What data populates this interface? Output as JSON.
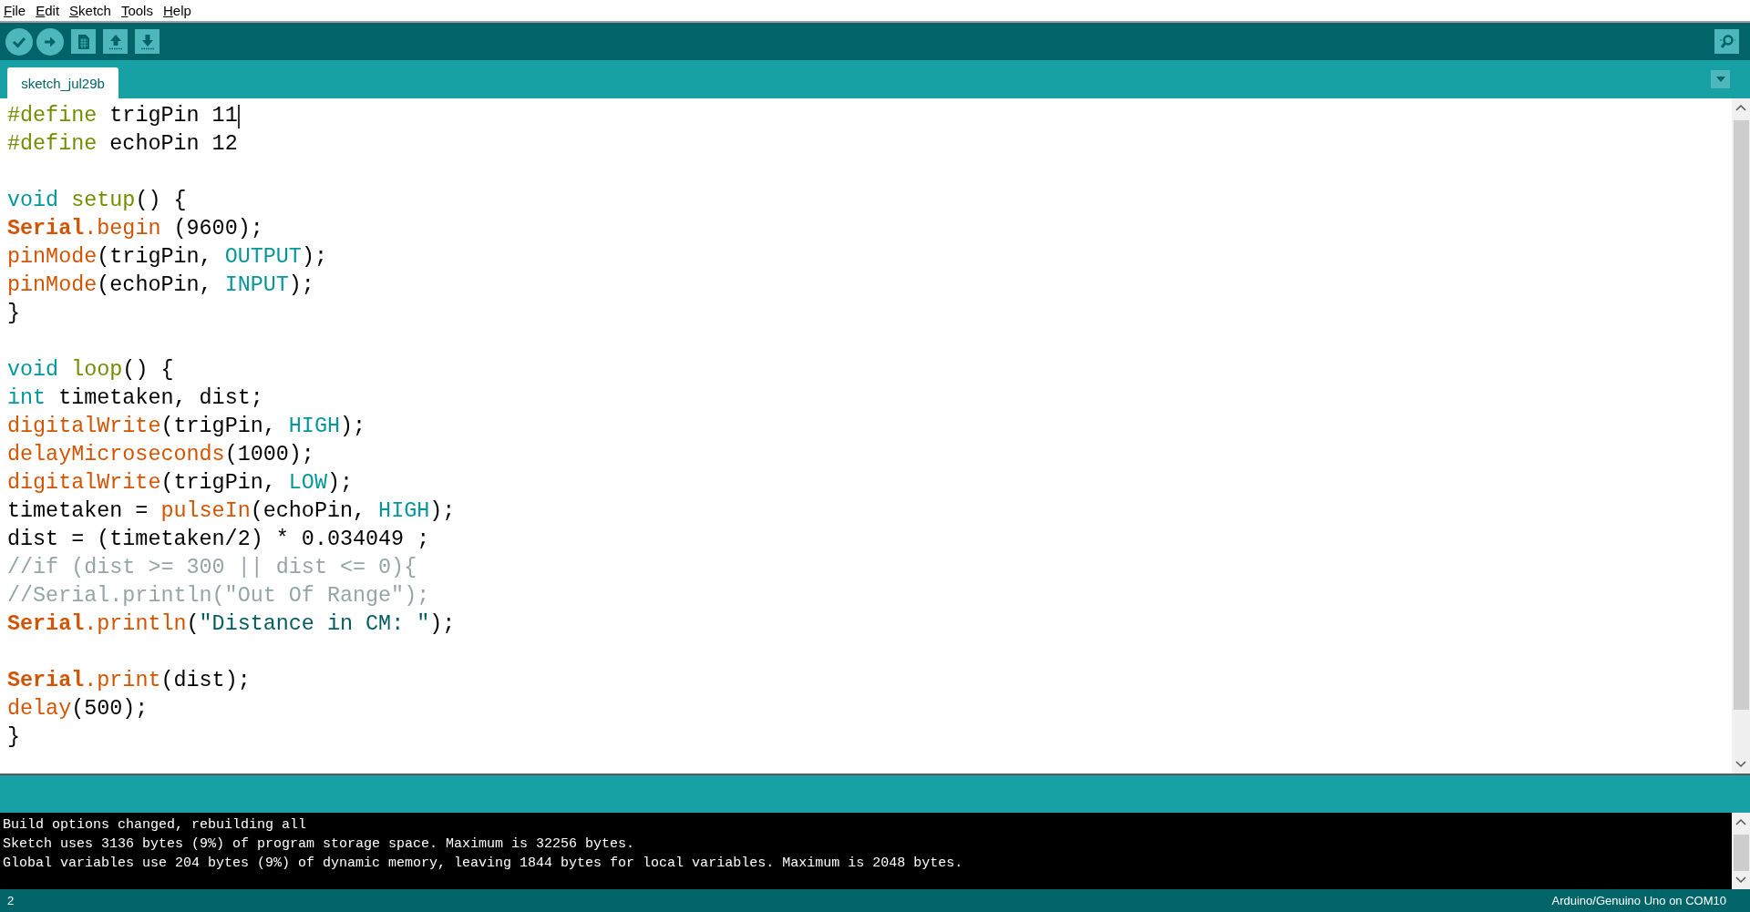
{
  "menu": [
    "File",
    "Edit",
    "Sketch",
    "Tools",
    "Help"
  ],
  "toolbar": [
    {
      "kind": "verify"
    },
    {
      "kind": "upload"
    },
    {
      "kind": "new"
    },
    {
      "kind": "open"
    },
    {
      "kind": "save"
    },
    {
      "kind": "monitor"
    }
  ],
  "tabs": [
    {
      "label": "sketch_jul29b",
      "selected": true
    }
  ],
  "code": [
    {
      "kind": "code",
      "caret": true,
      "tokens": [
        {
          "t": "#define",
          "kind": "pre"
        },
        {
          "t": " trigPin 11",
          "kind": "plain"
        }
      ]
    },
    {
      "kind": "code",
      "tokens": [
        {
          "t": "#define",
          "kind": "pre"
        },
        {
          "t": " echoPin 12",
          "kind": "plain"
        }
      ]
    },
    {
      "kind": "blank"
    },
    {
      "kind": "code",
      "tokens": [
        {
          "t": "void ",
          "kind": "kw"
        },
        {
          "t": "setup",
          "kind": "pre"
        },
        {
          "t": "() {",
          "kind": "plain"
        }
      ]
    },
    {
      "kind": "code",
      "tokens": [
        {
          "t": "Serial",
          "kind": "cls"
        },
        {
          "t": ".begin",
          "kind": "fn"
        },
        {
          "t": " (9600);",
          "kind": "plain"
        }
      ]
    },
    {
      "kind": "code",
      "tokens": [
        {
          "t": "pinMode",
          "kind": "fn"
        },
        {
          "t": "(trigPin, ",
          "kind": "plain"
        },
        {
          "t": "OUTPUT",
          "kind": "kw"
        },
        {
          "t": ");",
          "kind": "plain"
        }
      ]
    },
    {
      "kind": "code",
      "tokens": [
        {
          "t": "pinMode",
          "kind": "fn"
        },
        {
          "t": "(echoPin, ",
          "kind": "plain"
        },
        {
          "t": "INPUT",
          "kind": "kw"
        },
        {
          "t": ");",
          "kind": "plain"
        }
      ]
    },
    {
      "kind": "code",
      "tokens": [
        {
          "t": "}",
          "kind": "plain"
        }
      ]
    },
    {
      "kind": "blank"
    },
    {
      "kind": "code",
      "tokens": [
        {
          "t": "void ",
          "kind": "kw"
        },
        {
          "t": "loop",
          "kind": "pre"
        },
        {
          "t": "() {",
          "kind": "plain"
        }
      ]
    },
    {
      "kind": "code",
      "tokens": [
        {
          "t": "int",
          "kind": "kw"
        },
        {
          "t": " timetaken, dist;",
          "kind": "plain"
        }
      ]
    },
    {
      "kind": "code",
      "tokens": [
        {
          "t": "digitalWrite",
          "kind": "fn"
        },
        {
          "t": "(trigPin, ",
          "kind": "plain"
        },
        {
          "t": "HIGH",
          "kind": "kw"
        },
        {
          "t": ");",
          "kind": "plain"
        }
      ]
    },
    {
      "kind": "code",
      "tokens": [
        {
          "t": "delayMicroseconds",
          "kind": "fn"
        },
        {
          "t": "(1000);",
          "kind": "plain"
        }
      ]
    },
    {
      "kind": "code",
      "tokens": [
        {
          "t": "digitalWrite",
          "kind": "fn"
        },
        {
          "t": "(trigPin, ",
          "kind": "plain"
        },
        {
          "t": "LOW",
          "kind": "kw"
        },
        {
          "t": ");",
          "kind": "plain"
        }
      ]
    },
    {
      "kind": "code",
      "tokens": [
        {
          "t": "timetaken = ",
          "kind": "plain"
        },
        {
          "t": "pulseIn",
          "kind": "fn"
        },
        {
          "t": "(echoPin, ",
          "kind": "plain"
        },
        {
          "t": "HIGH",
          "kind": "kw"
        },
        {
          "t": ");",
          "kind": "plain"
        }
      ]
    },
    {
      "kind": "code",
      "tokens": [
        {
          "t": "dist = (timetaken/2) * 0.034049 ;",
          "kind": "plain"
        }
      ]
    },
    {
      "kind": "code",
      "tokens": [
        {
          "t": "//if (dist >= 300 || dist <= 0){",
          "kind": "comment"
        }
      ]
    },
    {
      "kind": "code",
      "tokens": [
        {
          "t": "//Serial.println(\"Out Of Range\");",
          "kind": "comment"
        }
      ]
    },
    {
      "kind": "code",
      "tokens": [
        {
          "t": "Serial",
          "kind": "cls"
        },
        {
          "t": ".println",
          "kind": "fn"
        },
        {
          "t": "(",
          "kind": "plain"
        },
        {
          "t": "\"Distance in CM: \"",
          "kind": "str"
        },
        {
          "t": ");",
          "kind": "plain"
        }
      ]
    },
    {
      "kind": "blank"
    },
    {
      "kind": "code",
      "tokens": [
        {
          "t": "Serial",
          "kind": "cls"
        },
        {
          "t": ".print",
          "kind": "fn"
        },
        {
          "t": "(dist);",
          "kind": "plain"
        }
      ]
    },
    {
      "kind": "code",
      "tokens": [
        {
          "t": "delay",
          "kind": "fn"
        },
        {
          "t": "(500);",
          "kind": "plain"
        }
      ]
    },
    {
      "kind": "code",
      "tokens": [
        {
          "t": "}",
          "kind": "plain"
        }
      ]
    }
  ],
  "console": [
    "Build options changed, rebuilding all",
    "Sketch uses 3136 bytes (9%) of program storage space. Maximum is 32256 bytes.",
    "Global variables use 204 bytes (9%) of dynamic memory, leaving 1844 bytes for local variables. Maximum is 2048 bytes."
  ],
  "status_bar": {
    "line": "2",
    "board": "Arduino/Genuino Uno on COM10"
  }
}
